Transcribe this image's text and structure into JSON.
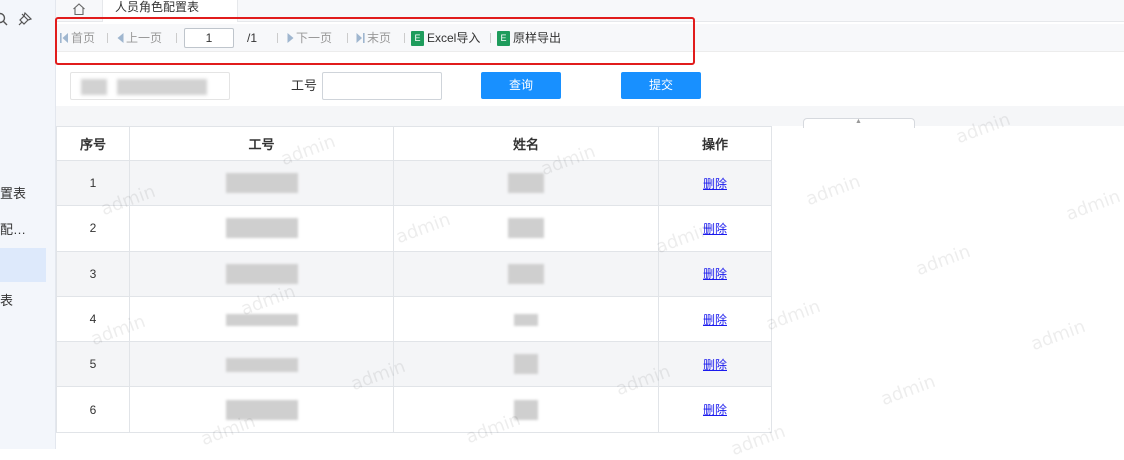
{
  "sidebar": {
    "items": [
      {
        "label": "置表"
      },
      {
        "label": "配…"
      },
      {
        "label": ""
      },
      {
        "label": "表"
      }
    ]
  },
  "tabs": {
    "active": "人员角色配置表"
  },
  "toolbar": {
    "first": "首页",
    "prev": "上一页",
    "page_value": "1",
    "total": "/1",
    "next": "下一页",
    "last": "末页",
    "excel_import": "Excel导入",
    "export": "原样导出"
  },
  "query": {
    "id_label": "工号",
    "search_button": "查询",
    "submit_button": "提交"
  },
  "table": {
    "headers": [
      "序号",
      "工号",
      "姓名",
      "操作"
    ],
    "rows": [
      {
        "index": "1",
        "action": "删除"
      },
      {
        "index": "2",
        "action": "删除"
      },
      {
        "index": "3",
        "action": "删除"
      },
      {
        "index": "4",
        "action": "删除"
      },
      {
        "index": "5",
        "action": "删除"
      },
      {
        "index": "6",
        "action": "删除"
      }
    ]
  },
  "watermark": "admin",
  "colors": {
    "primary": "#1890ff",
    "highlight": "#e11c1c",
    "excel": "#1e9c5c"
  }
}
